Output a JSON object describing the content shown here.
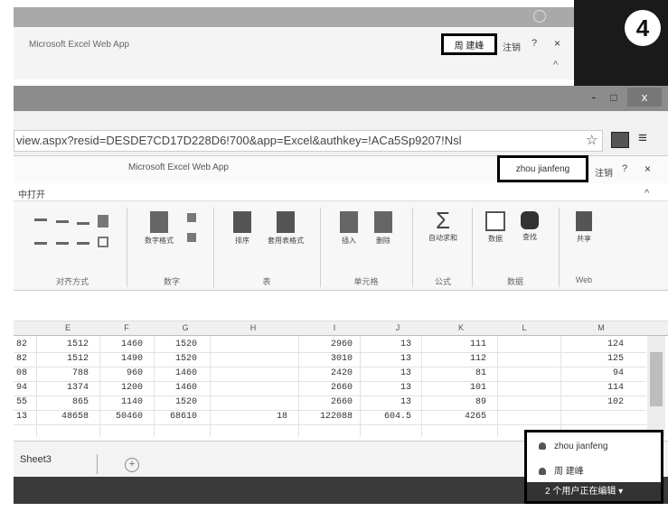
{
  "back_window": {
    "title": "Microsoft Excel Web App",
    "user_name": "周 建峰",
    "help_label": "注销",
    "help_q": "?",
    "close": "×",
    "caret": "^",
    "step_number": "4"
  },
  "browser": {
    "min": "-",
    "max": "□",
    "close": "x",
    "url": "view.aspx?resid=DESDE7CD17D228D6!700&app=Excel&authkey=!ACa5Sp9207!Nsl",
    "star": "☆",
    "menu": "≡"
  },
  "app": {
    "title": "Microsoft Excel Web App",
    "user_name": "zhou jianfeng",
    "signout": "注销",
    "help_q": "?",
    "close": "×",
    "ribbon_tab": "中打开",
    "collapse": "^"
  },
  "ribbon": {
    "groups": [
      {
        "label": "对齐方式"
      },
      {
        "label": "数字",
        "buttons": [
          "数字格式"
        ]
      },
      {
        "label": "表",
        "buttons": [
          "排序",
          "套用表格式"
        ]
      },
      {
        "label": "单元格",
        "buttons": [
          "插入",
          "删除"
        ]
      },
      {
        "label": "公式",
        "buttons": [
          "自动求和"
        ]
      },
      {
        "label": "数据",
        "buttons": [
          "数据",
          "查找"
        ]
      },
      {
        "label": "Web",
        "buttons": [
          "共享"
        ]
      }
    ]
  },
  "grid": {
    "columns": [
      "E",
      "F",
      "G",
      "H",
      "I",
      "J",
      "K",
      "L",
      "M"
    ],
    "rows": [
      [
        "82",
        "1512",
        "1460",
        "1520",
        "",
        "2960",
        "13",
        "111",
        "",
        "124"
      ],
      [
        "82",
        "1512",
        "1490",
        "1520",
        "",
        "3010",
        "13",
        "112",
        "",
        "125"
      ],
      [
        "08",
        "788",
        "960",
        "1460",
        "",
        "2420",
        "13",
        "81",
        "",
        "94"
      ],
      [
        "94",
        "1374",
        "1200",
        "1460",
        "",
        "2660",
        "13",
        "101",
        "",
        "114"
      ],
      [
        "55",
        "865",
        "1140",
        "1520",
        "",
        "2660",
        "13",
        "89",
        "",
        "102"
      ],
      [
        "13",
        "48658",
        "50460",
        "68610",
        "18",
        "122088",
        "604.5",
        "4265",
        "",
        ""
      ]
    ]
  },
  "sheets": {
    "active": "Sheet3",
    "add": "+"
  },
  "users_popup": {
    "items": [
      "zhou jianfeng",
      "周 建峰"
    ],
    "footer": "2 个用户正在编辑 ▾"
  }
}
